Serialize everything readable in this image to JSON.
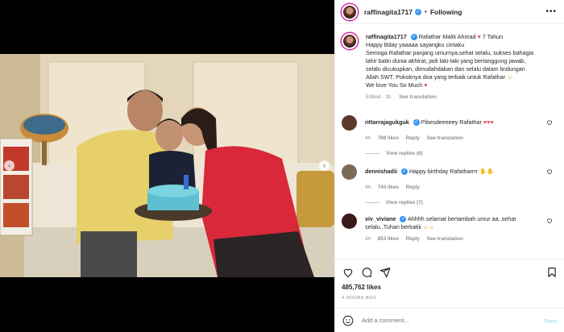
{
  "header": {
    "username": "raffinagita1717",
    "verified": true,
    "follow_status": "Following",
    "more_icon": "more-horizontal-icon"
  },
  "caption": {
    "username": "raffinagita1717",
    "line1_mention": "Rafathar Malik Ahmad",
    "line1_suffix": "7 Tahun",
    "body_lines": [
      "Happy Bday yaaaaa sayangku cintaku",
      "Semoga Rafathar panjang umurnya,sehat selalu, sukses bahagia",
      "lahir batin dunia akhirat, jadi laki-laki yang bertanggung jawab,",
      "selalu dicukupkan, dimudahdakan dan selalu dalam lindungan",
      "Allah SWT. Pokoknya doa yang terbaik untuk Rafathar",
      "We love You So Much"
    ],
    "edited": "Edited · 3h",
    "see_translation": "See translation"
  },
  "comments": [
    {
      "username": "rittarrajagukguk",
      "verified": true,
      "text": "Pibesdeeeeey Rafathar",
      "time": "4h",
      "likes": "788 likes",
      "reply": "Reply",
      "see_translation": "See translation",
      "view_replies": "View replies (6)",
      "avatar_color": "#5b3a2b"
    },
    {
      "username": "dennishadii",
      "verified": true,
      "text": "Happy birthday Rafatharrrr",
      "time": "4h",
      "likes": "744 likes",
      "reply": "Reply",
      "see_translation": "",
      "view_replies": "View replies (7)",
      "avatar_color": "#7a6a5a"
    },
    {
      "username": "viv_viviane",
      "verified": true,
      "text_lines": [
        "Ahhhh selamat bertambah umur aa..sehat",
        "selalu..Tuhan berkatiii"
      ],
      "time": "3h",
      "likes": "853 likes",
      "reply": "Reply",
      "see_translation": "See translation",
      "avatar_color": "#3a1a1a"
    }
  ],
  "likes_count": "485,762 likes",
  "time_ago": "4 HOURS AGO",
  "add_comment": {
    "placeholder": "Add a comment...",
    "post_label": "Post"
  },
  "colors": {
    "accent": "#3897f0",
    "heart_red": "#ed4956",
    "post_disabled": "#b2dffc"
  }
}
